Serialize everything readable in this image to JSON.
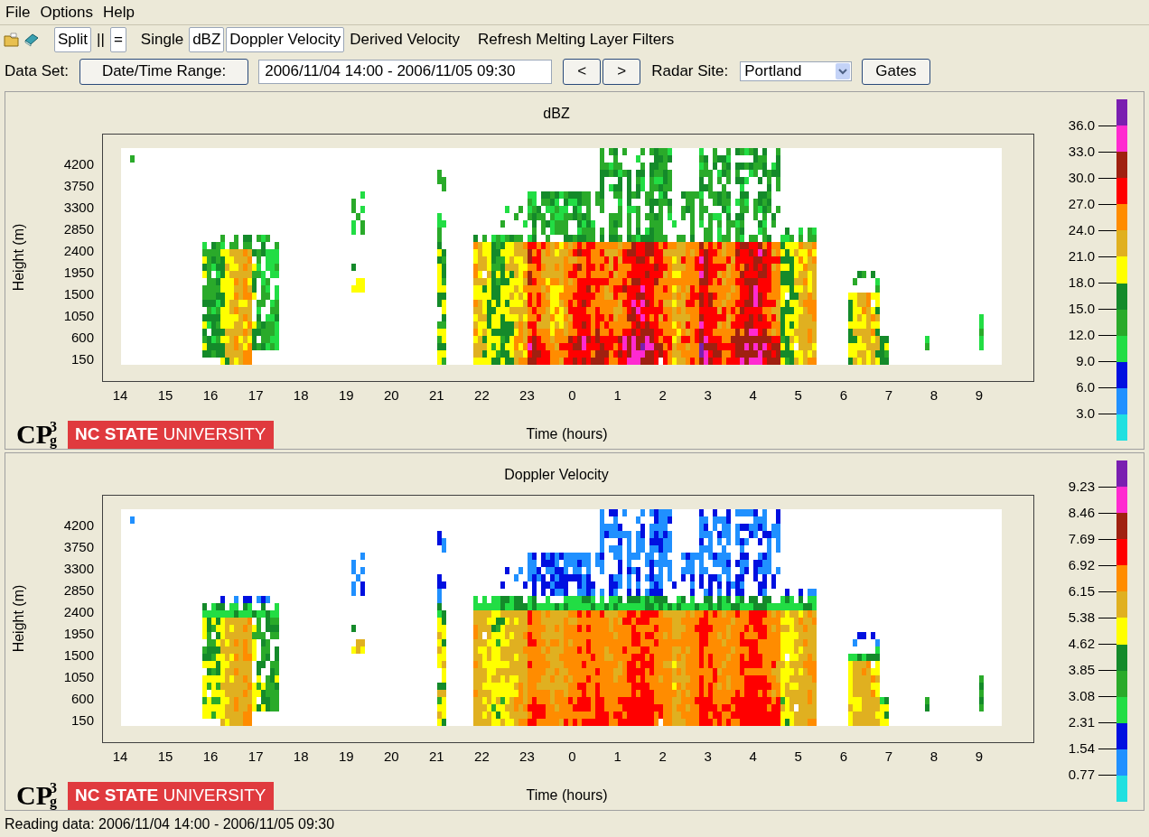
{
  "menu": [
    "File",
    "Options",
    "Help"
  ],
  "toolbar": [
    {
      "label": "Split",
      "selected": true
    },
    {
      "label": "||",
      "selected": false
    },
    {
      "label": "=",
      "selected": true
    },
    {
      "label": "Single",
      "selected": false
    },
    {
      "label": "dBZ",
      "selected": true
    },
    {
      "label": "Doppler Velocity",
      "selected": true
    },
    {
      "label": "Derived Velocity",
      "selected": false
    },
    {
      "label": "Refresh Melting Layer Filters",
      "selected": false
    }
  ],
  "data_set": {
    "label": "Data Set:",
    "range_button": "Date/Time Range:",
    "range_value": "2006/11/04 14:00 - 2006/11/05 09:30",
    "prev_button": "<",
    "next_button": ">",
    "site_label": "Radar Site:",
    "site_value": "Portland",
    "gates_button": "Gates"
  },
  "color_scale": [
    {
      "color": "#7a1fb0"
    },
    {
      "color": "#ff2ad0"
    },
    {
      "color": "#a02010"
    },
    {
      "color": "#ff0000"
    },
    {
      "color": "#ff8c00"
    },
    {
      "color": "#e0b020"
    },
    {
      "color": "#ffff00"
    },
    {
      "color": "#148a2a"
    },
    {
      "color": "#2aaa2a"
    },
    {
      "color": "#22dd44"
    },
    {
      "color": "#0010e0"
    },
    {
      "color": "#2090ff"
    },
    {
      "color": "#20e0e0"
    }
  ],
  "panels": [
    {
      "kind": "reflectivity",
      "title": "dBZ",
      "ylabel": "Height (m)",
      "xlabel": "Time (hours)",
      "yticks": [
        "4200",
        "3750",
        "3300",
        "2850",
        "2400",
        "1950",
        "1500",
        "1050",
        "600",
        "150"
      ],
      "xticks": [
        "14",
        "15",
        "16",
        "17",
        "18",
        "19",
        "20",
        "21",
        "22",
        "23",
        "0",
        "1",
        "2",
        "3",
        "4",
        "5",
        "6",
        "7",
        "8",
        "9"
      ],
      "scale_labels": [
        "36.0",
        "33.0",
        "30.0",
        "27.0",
        "24.0",
        "21.0",
        "18.0",
        "15.0",
        "12.0",
        "9.0",
        "6.0",
        "3.0"
      ],
      "logo": {
        "main": "CP",
        "sup": "3",
        "sub": "g"
      },
      "university": "**NC STATE** UNIVERSITY"
    },
    {
      "kind": "velocity",
      "title": "Doppler Velocity",
      "ylabel": "Height (m)",
      "xlabel": "Time (hours)",
      "yticks": [
        "4200",
        "3750",
        "3300",
        "2850",
        "2400",
        "1950",
        "1500",
        "1050",
        "600",
        "150"
      ],
      "xticks": [
        "14",
        "15",
        "16",
        "17",
        "18",
        "19",
        "20",
        "21",
        "22",
        "23",
        "0",
        "1",
        "2",
        "3",
        "4",
        "5",
        "6",
        "7",
        "8",
        "9"
      ],
      "scale_labels": [
        "9.23",
        "8.46",
        "7.69",
        "6.92",
        "6.15",
        "5.38",
        "4.62",
        "3.85",
        "3.08",
        "2.31",
        "1.54",
        "0.77"
      ],
      "logo": {
        "main": "CP",
        "sup": "3",
        "sub": "g"
      },
      "university": "**NC STATE** UNIVERSITY"
    }
  ],
  "status_bar": "Reading data: 2006/11/04 14:00 - 2006/11/05 09:30"
}
